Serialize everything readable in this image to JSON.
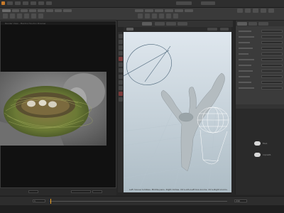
{
  "left_pane": {
    "title": "Render View - Mantra Houdini Preview"
  },
  "viewport": {
    "status": "Left mouse tumbles. Middle pans. Right dollies. Ctrl+Alt+Left box-zooms. Ctrl+Right zooms."
  },
  "timeline": {
    "current_frame": "1",
    "end_frame": "240"
  },
  "network": {
    "nodes": [
      {
        "label": "file1"
      },
      {
        "label": "ropnet1"
      }
    ]
  },
  "colors": {
    "accent": "#f0a020",
    "viewport_top": "#dfe7ee",
    "viewport_bottom": "#adbcc5",
    "nest_green": "#6b8a3a",
    "branch": "#b8c0c4"
  }
}
